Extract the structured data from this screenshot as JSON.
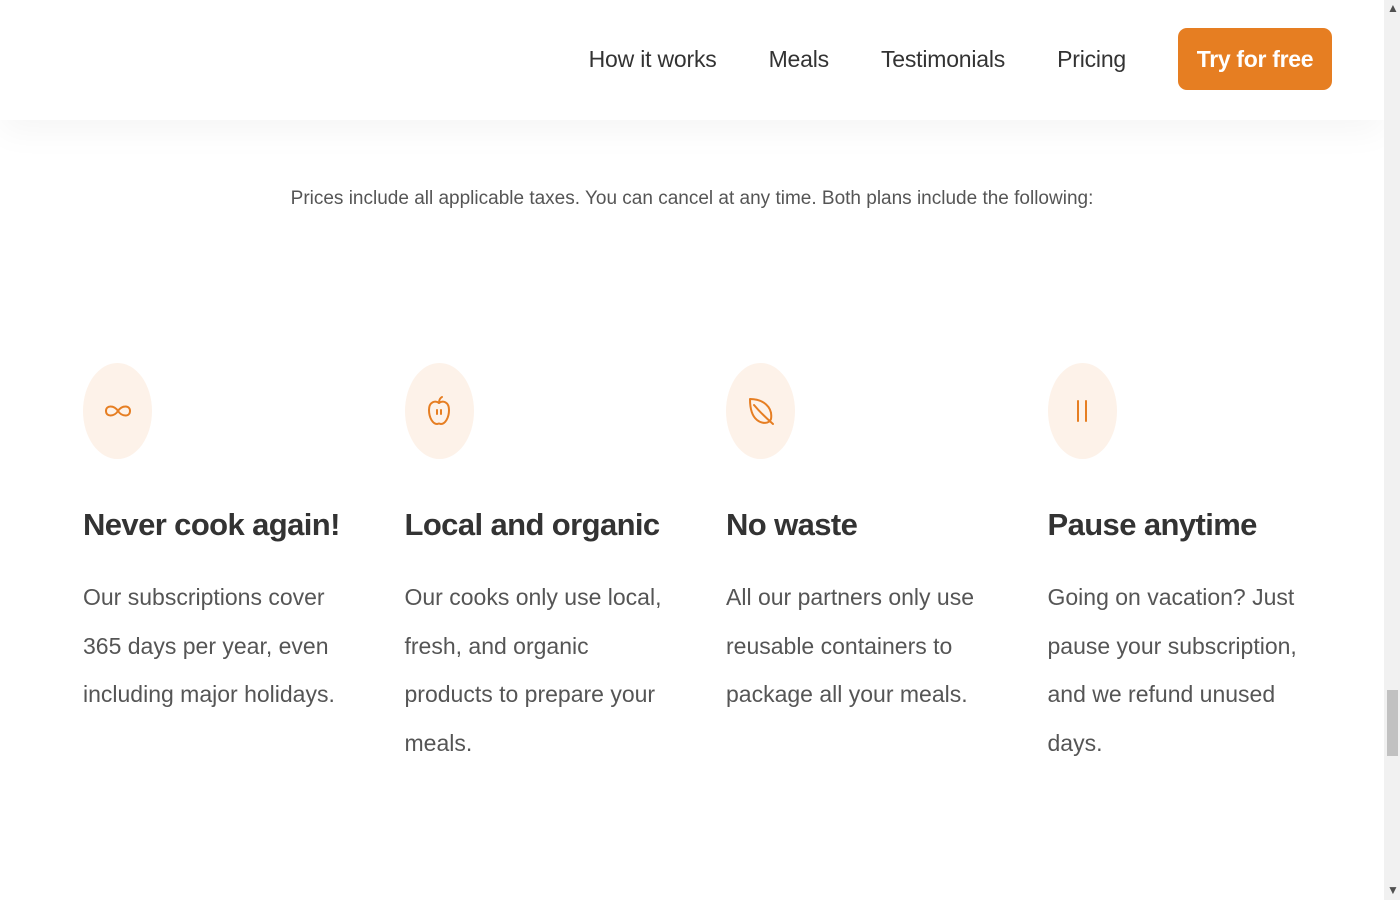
{
  "nav": {
    "links": [
      "How it works",
      "Meals",
      "Testimonials",
      "Pricing"
    ],
    "cta": "Try for free"
  },
  "pricing_note": "Prices include all applicable taxes. You can cancel at any time. Both plans include the following:",
  "features": [
    {
      "icon": "infinity-icon",
      "title": "Never cook again!",
      "text": "Our subscriptions cover 365 days per year, even including major holidays."
    },
    {
      "icon": "apple-icon",
      "title": "Local and organic",
      "text": "Our cooks only use local, fresh, and organic products to prepare your meals."
    },
    {
      "icon": "leaf-icon",
      "title": "No waste",
      "text": "All our partners only use reusable containers to package all your meals."
    },
    {
      "icon": "pause-icon",
      "title": "Pause anytime",
      "text": "Going on vacation? Just pause your subscription, and we refund unused days."
    }
  ],
  "colors": {
    "accent": "#e67e22",
    "icon_bg": "#fdf2e9",
    "text": "#333333",
    "muted": "#555555"
  }
}
